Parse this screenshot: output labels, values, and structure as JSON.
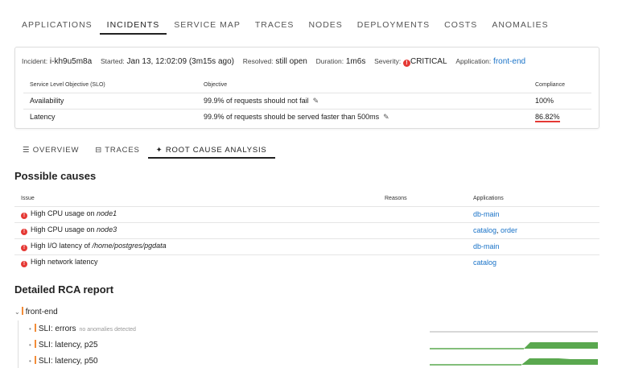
{
  "top_tabs": [
    "APPLICATIONS",
    "INCIDENTS",
    "SERVICE MAP",
    "TRACES",
    "NODES",
    "DEPLOYMENTS",
    "COSTS",
    "ANOMALIES"
  ],
  "incident": {
    "incident_label": "Incident:",
    "incident_id": "i-kh9u5m8a",
    "started_label": "Started:",
    "started": "Jan 13, 12:02:09 (3m15s ago)",
    "resolved_label": "Resolved:",
    "resolved": "still open",
    "duration_label": "Duration:",
    "duration": "1m6s",
    "severity_label": "Severity:",
    "severity": "CRITICAL",
    "application_label": "Application:",
    "application": "front-end"
  },
  "slo": {
    "headers": [
      "Service Level Objective (SLO)",
      "Objective",
      "Compliance"
    ],
    "rows": [
      {
        "name": "Availability",
        "objective": "99.9% of requests should not fail",
        "compliance": "100%"
      },
      {
        "name": "Latency",
        "objective": "99.9% of requests should be served faster than 500ms",
        "compliance": "86.82%"
      }
    ]
  },
  "sub_tabs": [
    {
      "icon": "list-icon",
      "glyph": "☰",
      "label": "OVERVIEW"
    },
    {
      "icon": "traces-icon",
      "glyph": "⊟",
      "label": "TRACES"
    },
    {
      "icon": "sparkle-icon",
      "glyph": "✦",
      "label": "ROOT CAUSE ANALYSIS"
    }
  ],
  "possible_causes": {
    "title": "Possible causes",
    "headers": [
      "Issue",
      "Reasons",
      "Applications"
    ],
    "rows": [
      {
        "issue": "High CPU usage on ",
        "target": "node1",
        "apps": [
          "db-main"
        ]
      },
      {
        "issue": "High CPU usage on ",
        "target": "node3",
        "apps": [
          "catalog",
          "order"
        ]
      },
      {
        "issue": "High I/O latency of ",
        "target": "/home/postgres/pgdata",
        "apps": [
          "db-main"
        ]
      },
      {
        "issue": "High network latency",
        "target": "",
        "apps": [
          "catalog"
        ]
      }
    ]
  },
  "rca": {
    "title": "Detailed RCA report",
    "app": "front-end",
    "items": [
      {
        "label": "SLI: errors",
        "note": "no anomalies detected"
      },
      {
        "label": "SLI: latency, p25",
        "note": ""
      },
      {
        "label": "SLI: latency, p50",
        "note": ""
      }
    ]
  },
  "colors": {
    "accent": "#1a73c8",
    "critical": "#e53935",
    "sli_marker": "#f28c38",
    "sparkline": "#5aa84f"
  }
}
